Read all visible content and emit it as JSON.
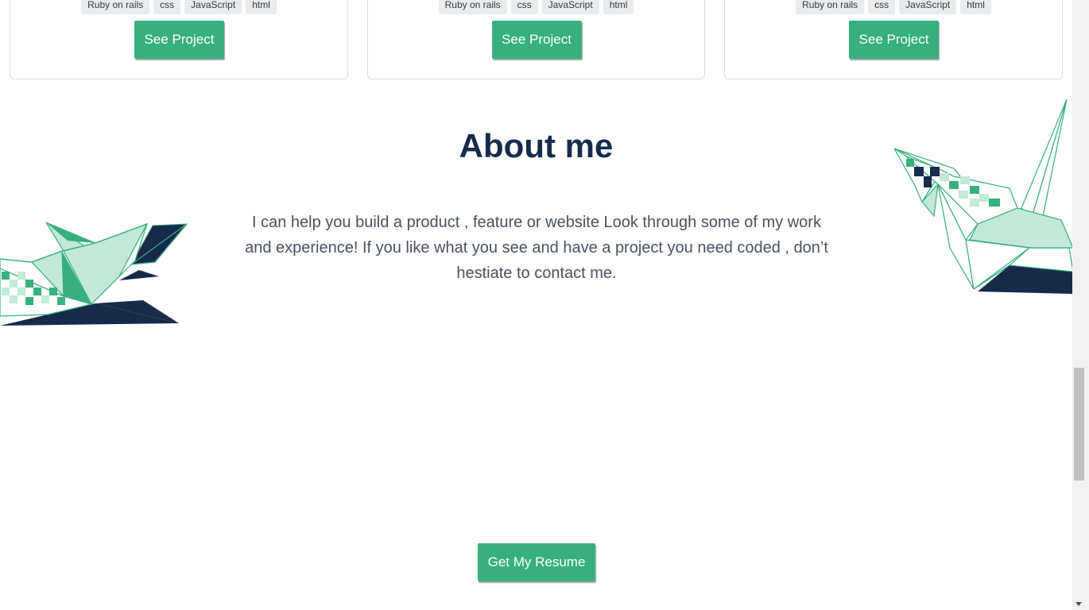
{
  "projects": [
    {
      "tags": [
        "Ruby on rails",
        "css",
        "JavaScript",
        "html"
      ],
      "button_label": "See Project"
    },
    {
      "tags": [
        "Ruby on rails",
        "css",
        "JavaScript",
        "html"
      ],
      "button_label": "See Project"
    },
    {
      "tags": [
        "Ruby on rails",
        "css",
        "JavaScript",
        "html"
      ],
      "button_label": "See Project"
    }
  ],
  "about": {
    "title": "About me",
    "text": "I can help you build a product , feature or website Look through some of my work and experience! If you like what you see and have a project you need coded , don’t hestiate to contact me."
  },
  "resume": {
    "button_label": "Get My Resume"
  },
  "colors": {
    "accent": "#37b07d",
    "navy": "#172a4a",
    "light_green": "#c3e9d8"
  }
}
